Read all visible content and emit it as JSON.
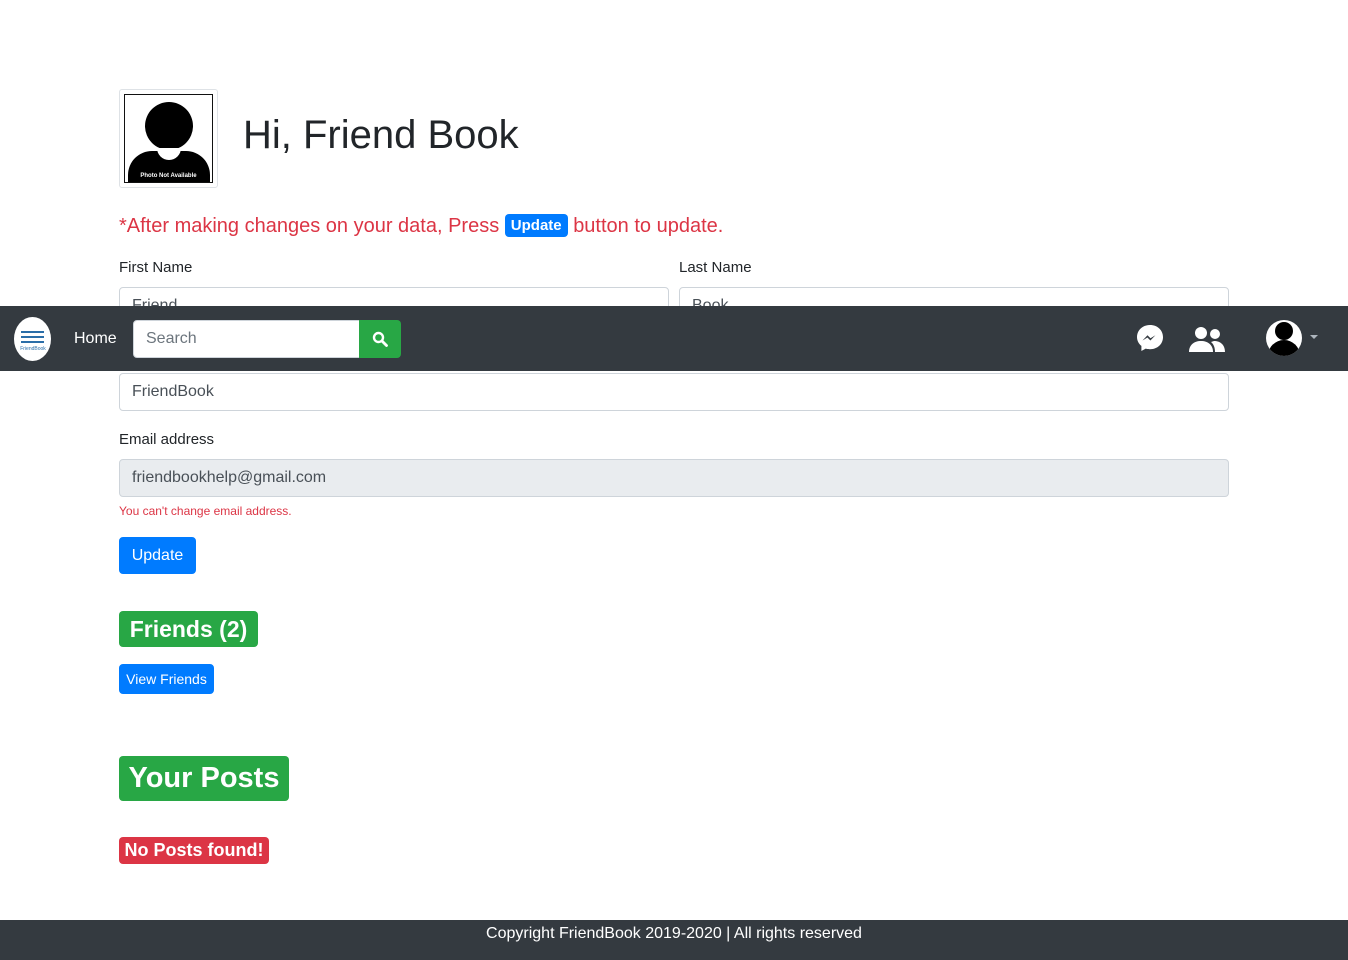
{
  "profile": {
    "photo_caption": "Photo Not Available",
    "greeting": "Hi, Friend Book"
  },
  "notice": {
    "prefix": "*After making changes on your data, Press",
    "badge": "Update",
    "suffix": "button to update."
  },
  "form": {
    "first_name_label": "First Name",
    "first_name_value": "Friend",
    "last_name_label": "Last Name",
    "last_name_value": "Book",
    "username_value": "FriendBook",
    "email_label": "Email address",
    "email_value": "friendbookhelp@gmail.com",
    "email_help": "You can't change email address.",
    "update_button": "Update"
  },
  "friends": {
    "heading": "Friends (2)",
    "view_button": "View Friends"
  },
  "posts": {
    "heading": "Your Posts",
    "empty_badge": "No Posts found!"
  },
  "navbar": {
    "logo_text": "FriendBook",
    "home_label": "Home",
    "search_placeholder": "Search",
    "icons": [
      "search-icon",
      "messenger-icon",
      "friends-icon",
      "user-avatar"
    ]
  },
  "footer": {
    "text": "Copyright FriendBook 2019-2020 | All rights reserved"
  },
  "colors": {
    "navbar_bg": "#343a40",
    "primary": "#007bff",
    "success": "#28a745",
    "danger": "#dc3545"
  }
}
